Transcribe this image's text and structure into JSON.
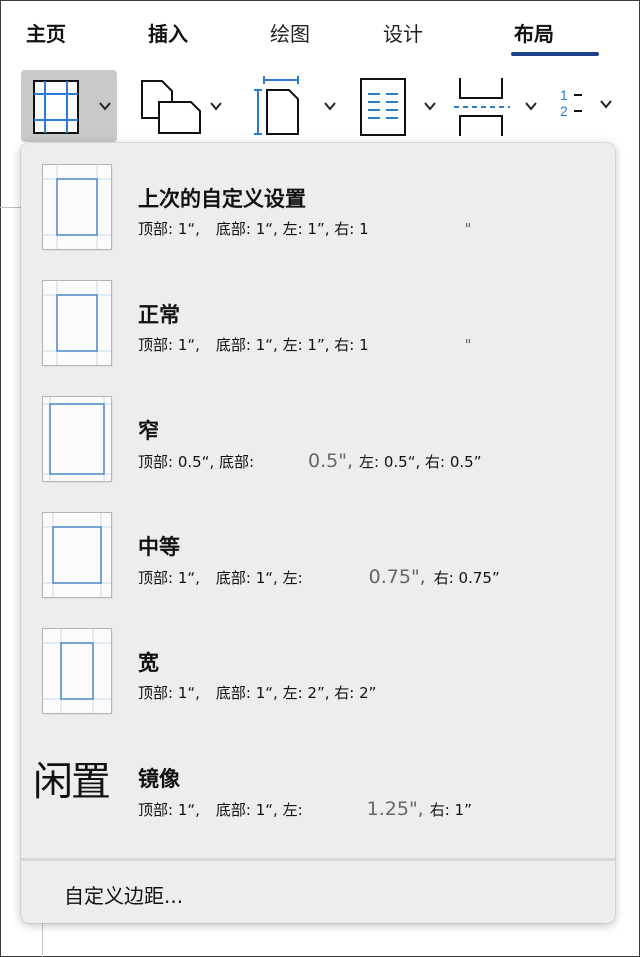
{
  "ribbon": {
    "tabs": [
      {
        "label": "主页"
      },
      {
        "label": "插入"
      },
      {
        "label": "绘图"
      },
      {
        "label": "设计"
      },
      {
        "label": "布局"
      }
    ],
    "active_tab": "布局",
    "accent_color": "#1e3f8a",
    "tools": [
      {
        "icon": "margins-icon"
      },
      {
        "icon": "orientation-icon"
      },
      {
        "icon": "size-icon"
      },
      {
        "icon": "columns-icon"
      },
      {
        "icon": "breaks-icon"
      },
      {
        "icon": "line-numbers-icon"
      }
    ]
  },
  "menu": {
    "items": [
      {
        "title": "上次的自定义设置",
        "detail": [
          "顶部: 1“,",
          "底部: 1“, 左: 1”, 右: 1",
          "\""
        ]
      },
      {
        "title": "正常",
        "detail": [
          "顶部: 1“,",
          "底部: 1“, 左: 1”, 右: 1",
          "\""
        ]
      },
      {
        "title": "窄",
        "detail": [
          "顶部: 0.5“, 底部:",
          "0.5\",",
          "左: 0.5“, 右: 0.5”"
        ]
      },
      {
        "title": "中等",
        "detail": [
          "顶部: 1“,",
          "底部: 1“, 左:",
          "0.75\",",
          "右: 0.75”"
        ]
      },
      {
        "title": "宽",
        "detail": [
          "顶部: 1“,",
          "底部: 1“, 左: 2”, 右: 2”"
        ]
      },
      {
        "title": "镜像",
        "thumb_text": "闲置",
        "detail": [
          "顶部: 1“,",
          "底部: 1“, 左:",
          "1.25\",",
          "右: 1”"
        ]
      }
    ],
    "custom_label": "自定义边距..."
  }
}
